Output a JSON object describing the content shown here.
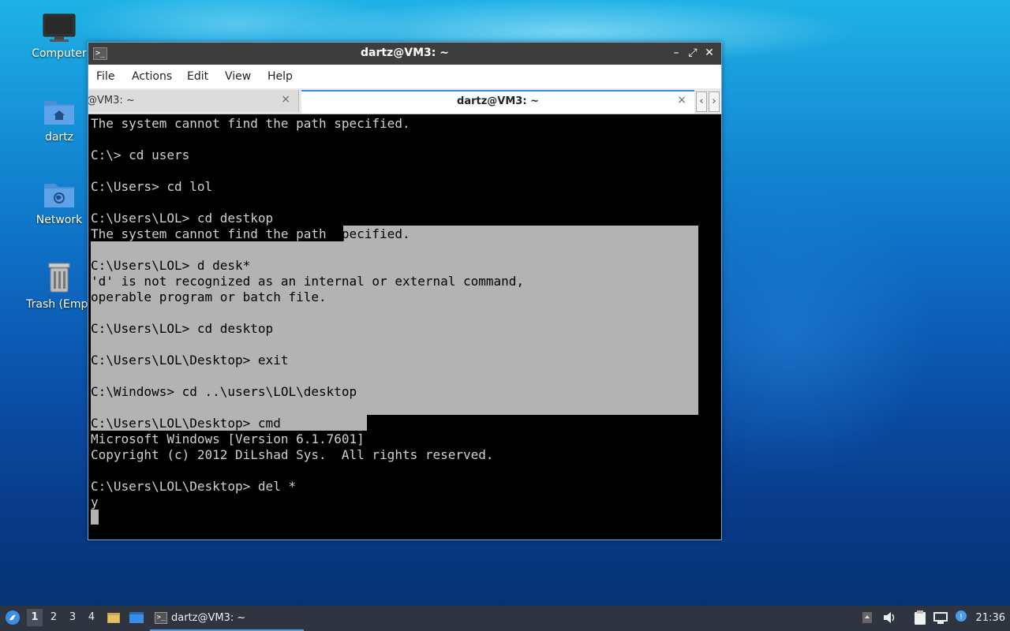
{
  "desktop": {
    "icons": [
      {
        "label": "Computer"
      },
      {
        "label": "dartz"
      },
      {
        "label": "Network"
      },
      {
        "label": "Trash (Empt"
      }
    ]
  },
  "window": {
    "title": "dartz@VM3: ~",
    "menu": [
      "File",
      "Actions",
      "Edit",
      "View",
      "Help"
    ],
    "tabs": [
      {
        "label": "@VM3: ~",
        "close": "×"
      },
      {
        "label": "dartz@VM3: ~",
        "close": "×"
      }
    ],
    "tab_prev": "‹",
    "tab_next": "›"
  },
  "terminal": {
    "lines": [
      "The system cannot find the path specified.",
      "",
      "C:\\> cd users",
      "",
      "C:\\Users> cd lol",
      "",
      "C:\\Users\\LOL> cd destkop",
      "The system cannot find the path specified.",
      "",
      "C:\\Users\\LOL> d desk*",
      "'d' is not recognized as an internal or external command,",
      "operable program or batch file.",
      "",
      "C:\\Users\\LOL> cd desktop",
      "",
      "C:\\Users\\LOL\\Desktop> exit",
      "",
      "C:\\Windows> cd ..\\users\\LOL\\desktop",
      "",
      "C:\\Users\\LOL\\Desktop> cmd",
      "Microsoft Windows [Version 6.1.7601]",
      "Copyright (c) 2012 DiLshad Sys.  All rights reserved.",
      "",
      "C:\\Users\\LOL\\Desktop> del *",
      "y"
    ]
  },
  "taskbar": {
    "workspaces": [
      "1",
      "2",
      "3",
      "4"
    ],
    "active_window": "dartz@VM3: ~",
    "clock": "21:36"
  },
  "colors": {
    "accent": "#3a8ee6",
    "titlebar": "#3d3d3d",
    "selection": "#b3b3b3"
  }
}
